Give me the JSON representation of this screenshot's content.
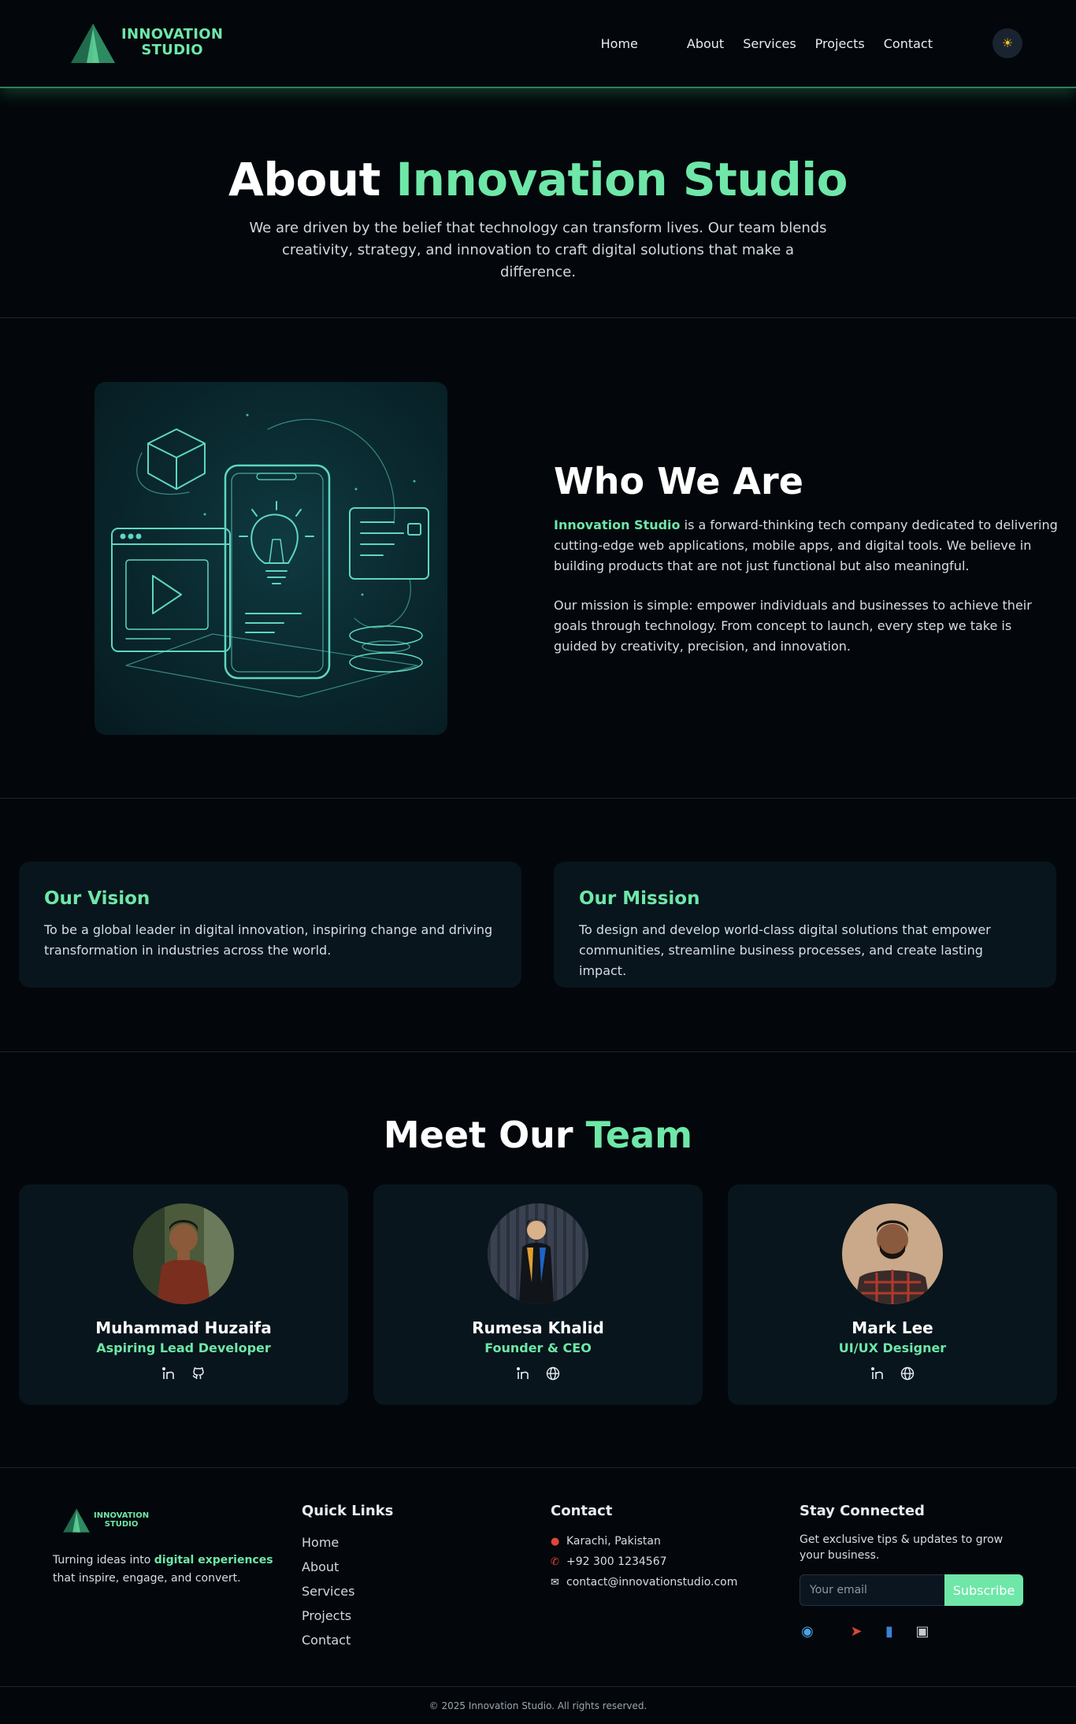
{
  "brand": {
    "line1": "INNOVATION",
    "line2": "STUDIO",
    "accent_color": "#6ee7a8"
  },
  "nav": {
    "items": [
      {
        "label": "Home"
      },
      {
        "label": "About"
      },
      {
        "label": "Services"
      },
      {
        "label": "Projects"
      },
      {
        "label": "Contact"
      }
    ],
    "theme_icon": "sun-icon"
  },
  "hero": {
    "title_white": "About ",
    "title_accent": "Innovation Studio",
    "description": "We are driven by the belief that technology can transform lives. Our team blends creativity, strategy, and innovation to craft digital solutions that make a difference."
  },
  "who": {
    "title": "Who We Are",
    "p1_brand": "Innovation Studio",
    "p1_rest": " is a forward-thinking tech company dedicated to delivering cutting-edge web applications, mobile apps, and digital tools. We believe in building products that are not just functional but also meaningful.",
    "p2": "Our mission is simple: empower individuals and businesses to achieve their goals through technology. From concept to launch, every step we take is guided by creativity, precision, and innovation."
  },
  "vision": {
    "title": "Our Vision",
    "text": "To be a global leader in digital innovation, inspiring change and driving transformation in industries across the world."
  },
  "mission": {
    "title": "Our Mission",
    "text": "To design and develop world-class digital solutions that empower communities, streamline business processes, and create lasting impact."
  },
  "team": {
    "title_white": "Meet Our ",
    "title_accent": "Team",
    "members": [
      {
        "name": "Muhammad Huzaifa",
        "role": "Aspiring Lead Developer",
        "icons": [
          "linkedin-icon",
          "github-icon"
        ]
      },
      {
        "name": "Rumesa Khalid",
        "role": "Founder & CEO",
        "icons": [
          "linkedin-icon",
          "globe-icon"
        ]
      },
      {
        "name": "Mark Lee",
        "role": "UI/UX Designer",
        "icons": [
          "linkedin-icon",
          "globe-icon"
        ]
      }
    ]
  },
  "footer": {
    "tagline_pre": "Turning ideas into ",
    "tagline_accent": "digital experiences",
    "tagline_post": " that inspire, engage, and convert.",
    "quick_links_title": "Quick Links",
    "quick_links": [
      "Home",
      "About",
      "Services",
      "Projects",
      "Contact"
    ],
    "contact_title": "Contact",
    "contact": {
      "location": "Karachi, Pakistan",
      "phone": "+92 300 1234567",
      "email": "contact@innovationstudio.com"
    },
    "stay_title": "Stay Connected",
    "stay_desc": "Get exclusive tips & updates to grow your business.",
    "email_placeholder": "Your email",
    "subscribe_label": "Subscribe",
    "socials": [
      "globe-icon",
      "bird-icon",
      "book-icon",
      "camera-icon"
    ],
    "copyright": "© 2025 Innovation Studio. All rights reserved."
  }
}
